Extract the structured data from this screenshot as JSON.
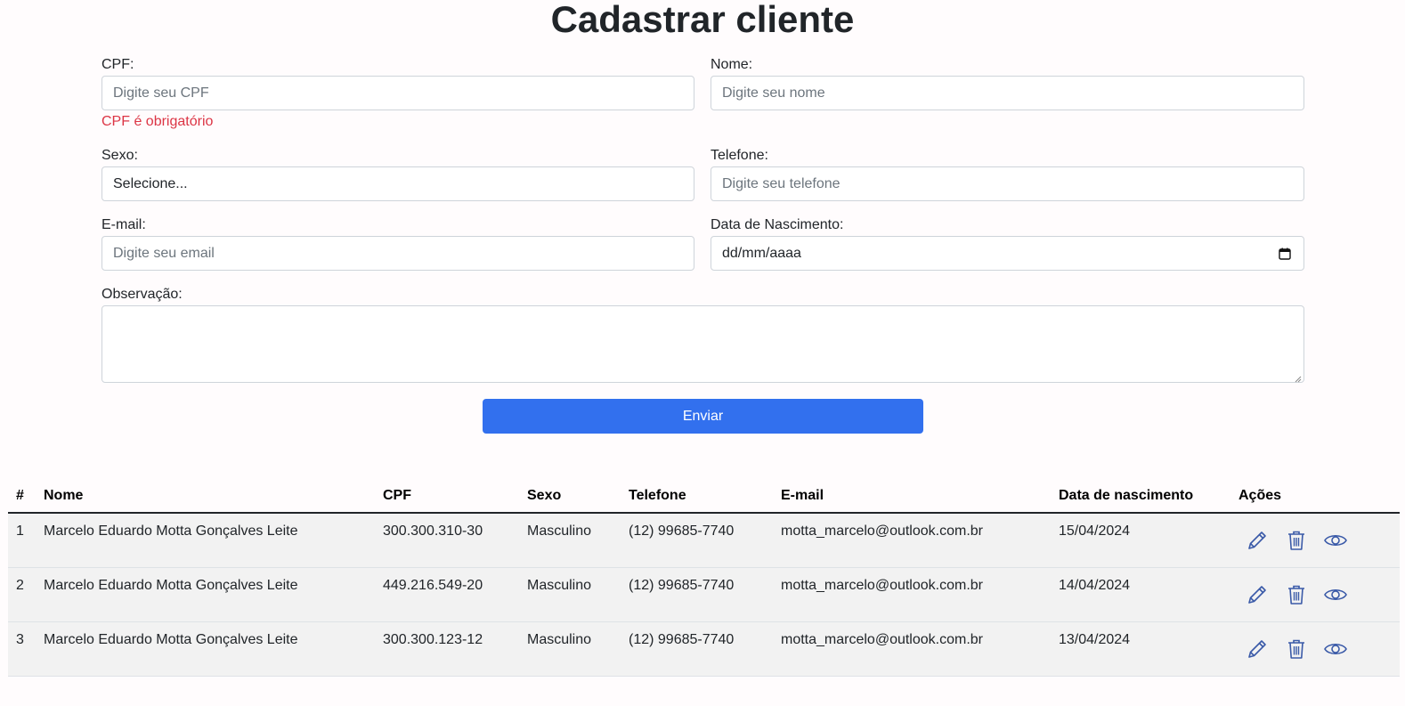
{
  "page_title": "Cadastrar cliente",
  "form": {
    "cpf": {
      "label": "CPF:",
      "placeholder": "Digite seu CPF",
      "error": "CPF é obrigatório"
    },
    "nome": {
      "label": "Nome:",
      "placeholder": "Digite seu nome"
    },
    "sexo": {
      "label": "Sexo:",
      "selected": "Selecione..."
    },
    "telefone": {
      "label": "Telefone:",
      "placeholder": "Digite seu telefone"
    },
    "email": {
      "label": "E-mail:",
      "placeholder": "Digite seu email"
    },
    "nascimento": {
      "label": "Data de Nascimento:",
      "value": "dd/mm/aaaa",
      "icon": "calendar-icon"
    },
    "observacao": {
      "label": "Observação:",
      "value": ""
    },
    "submit_label": "Enviar"
  },
  "colors": {
    "primary": "#3270ee",
    "error": "#dc3545",
    "icon": "#3a5aa8",
    "row_bg": "#f2f2f2"
  },
  "table": {
    "headers": [
      "#",
      "Nome",
      "CPF",
      "Sexo",
      "Telefone",
      "E-mail",
      "Data de nascimento",
      "Ações"
    ],
    "rows": [
      {
        "id": "1",
        "nome": "Marcelo Eduardo Motta Gonçalves Leite",
        "cpf": "300.300.310-30",
        "sexo": "Masculino",
        "telefone": "(12) 99685-7740",
        "email": "motta_marcelo@outlook.com.br",
        "nascimento": "15/04/2024"
      },
      {
        "id": "2",
        "nome": "Marcelo Eduardo Motta Gonçalves Leite",
        "cpf": "449.216.549-20",
        "sexo": "Masculino",
        "telefone": "(12) 99685-7740",
        "email": "motta_marcelo@outlook.com.br",
        "nascimento": "14/04/2024"
      },
      {
        "id": "3",
        "nome": "Marcelo Eduardo Motta Gonçalves Leite",
        "cpf": "300.300.123-12",
        "sexo": "Masculino",
        "telefone": "(12) 99685-7740",
        "email": "motta_marcelo@outlook.com.br",
        "nascimento": "13/04/2024"
      }
    ],
    "action_icons": [
      "pencil-icon",
      "trash-icon",
      "eye-icon"
    ]
  }
}
